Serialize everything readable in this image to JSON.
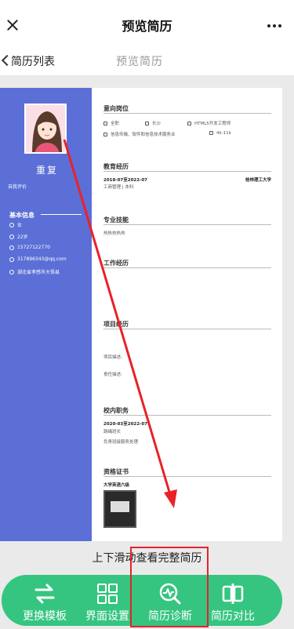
{
  "nav": {
    "title": "预览简历"
  },
  "subbar": {
    "back_label": "简历列表",
    "title": "预览简历"
  },
  "resume": {
    "name": "重复",
    "self_eval": "自我评价",
    "basic": {
      "title": "基本信息",
      "gender": "女",
      "age": "22岁",
      "phone": "15727122770",
      "email": "317896343@qq.com",
      "hometown": "湖北省孝感市大悟县"
    },
    "intention": {
      "title": "意向岗位",
      "job_type": "全职",
      "city": "长沙",
      "position": "HTML5开发工程师",
      "industry": "信息传输、软件和信息技术服务业",
      "salary": "4k-11k"
    },
    "education": {
      "title": "教育经历",
      "period": "2018-07至2022-07",
      "school": "桂林理工大学",
      "major": "工商管理 | 本科"
    },
    "skills": {
      "title": "专业技能",
      "content": "热热热热热"
    },
    "work": {
      "title": "工作经历"
    },
    "project": {
      "title": "项目经历",
      "desc_label": "项目描述:",
      "role_label": "责任描述:"
    },
    "campus": {
      "title": "校内职务",
      "period": "2020-03至2022-07",
      "role": "跳绳班长",
      "desc": "负责班级服务处理"
    },
    "certs": {
      "title": "资格证书",
      "name": "大学英语六级"
    }
  },
  "hint": "上下滑动查看完整简历",
  "toolbar": {
    "items": [
      {
        "label": "更换模板"
      },
      {
        "label": "界面设置"
      },
      {
        "label": "简历诊断"
      },
      {
        "label": "简历对比"
      }
    ]
  },
  "colors": {
    "sidebar": "#5b6fd6",
    "toolbar": "#35c580",
    "annotation": "#e8222a"
  }
}
